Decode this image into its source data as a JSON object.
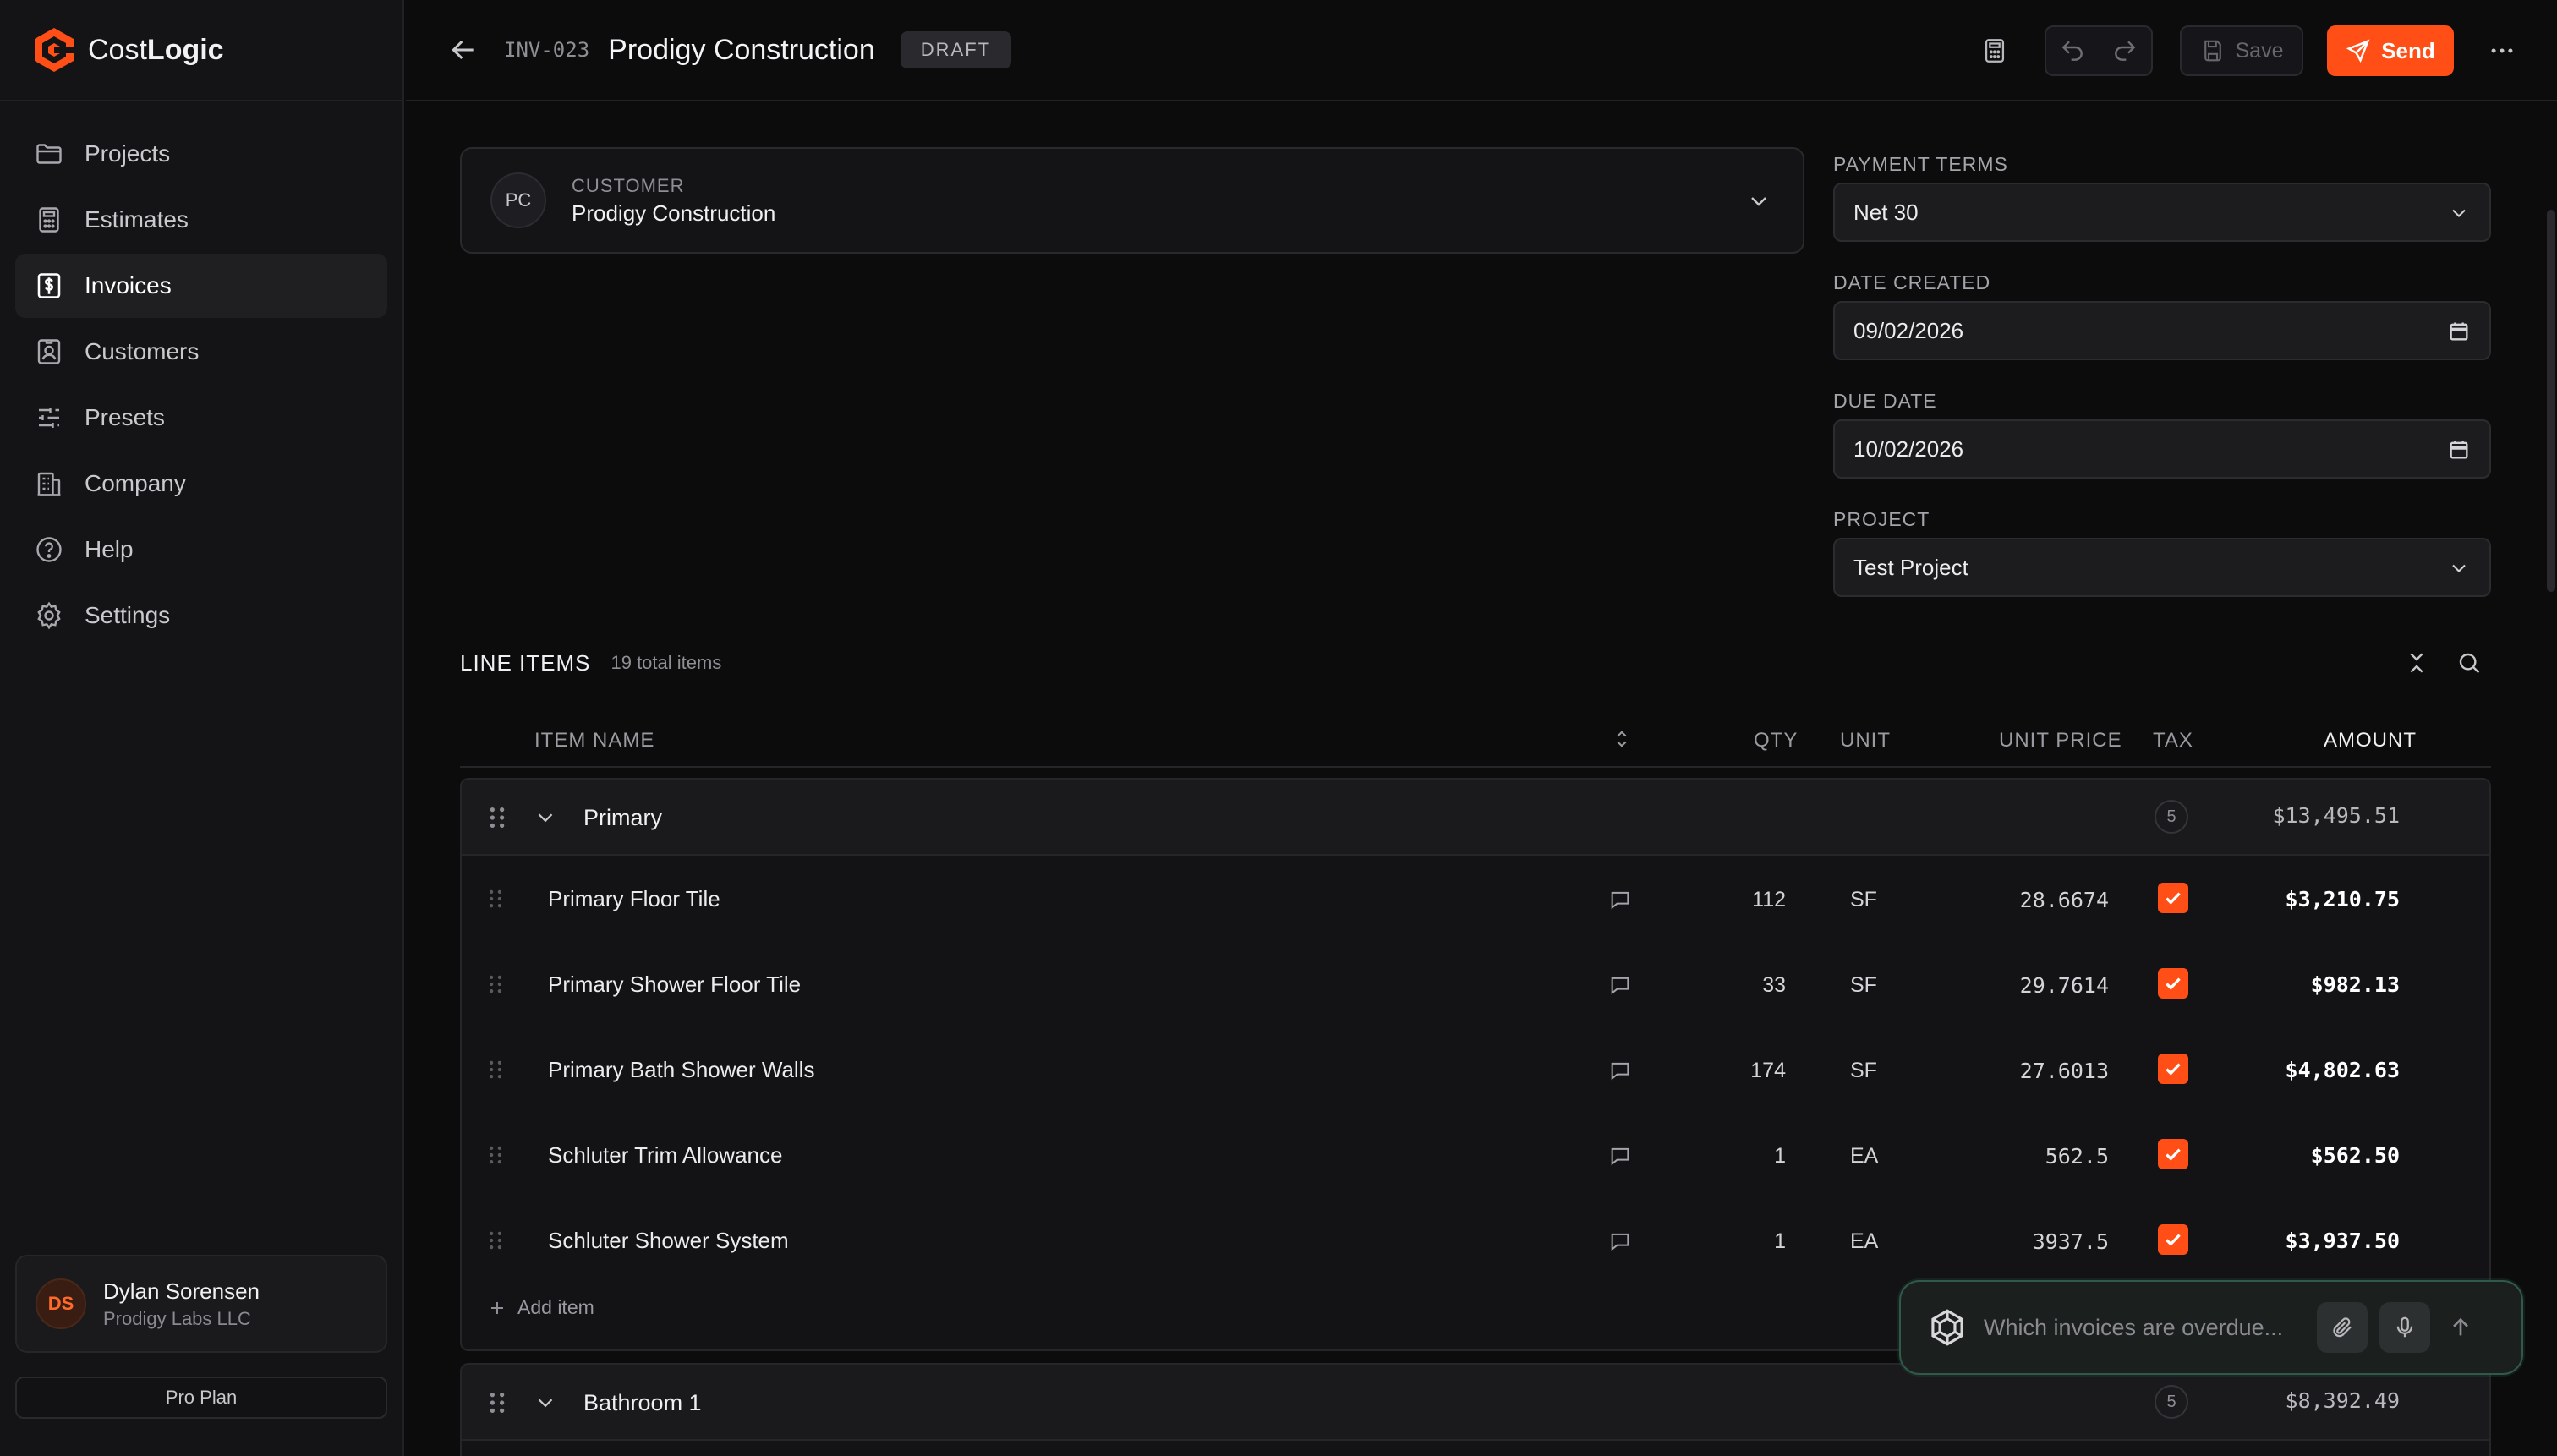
{
  "brand": {
    "name_light": "Cost",
    "name_bold": "Logic",
    "accent": "#ff4f17"
  },
  "sidebar": {
    "items": [
      {
        "label": "Projects",
        "icon": "folder-icon"
      },
      {
        "label": "Estimates",
        "icon": "calculator-icon"
      },
      {
        "label": "Invoices",
        "icon": "invoice-icon",
        "active": true
      },
      {
        "label": "Customers",
        "icon": "contact-card-icon"
      },
      {
        "label": "Presets",
        "icon": "sliders-icon"
      },
      {
        "label": "Company",
        "icon": "building-icon"
      },
      {
        "label": "Help",
        "icon": "help-circle-icon"
      },
      {
        "label": "Settings",
        "icon": "gear-icon"
      }
    ],
    "user": {
      "initials": "DS",
      "name": "Dylan Sorensen",
      "org": "Prodigy Labs LLC"
    },
    "plan": "Pro Plan"
  },
  "header": {
    "invoice_id": "INV-023",
    "title": "Prodigy Construction",
    "status": "DRAFT",
    "save_label": "Save",
    "send_label": "Send"
  },
  "customer": {
    "initials": "PC",
    "label": "CUSTOMER",
    "name": "Prodigy Construction"
  },
  "form": {
    "payment_terms": {
      "label": "PAYMENT TERMS",
      "value": "Net 30"
    },
    "date_created": {
      "label": "DATE CREATED",
      "value": "09/02/2026"
    },
    "due_date": {
      "label": "DUE DATE",
      "value": "10/02/2026"
    },
    "project": {
      "label": "PROJECT",
      "value": "Test Project"
    }
  },
  "line_items": {
    "title": "LINE ITEMS",
    "count": "19 total items",
    "columns": {
      "item_name": "ITEM NAME",
      "qty": "QTY",
      "unit": "UNIT",
      "unit_price": "UNIT PRICE",
      "tax": "TAX",
      "amount": "AMOUNT"
    },
    "groups": [
      {
        "name": "Primary",
        "count": "5",
        "total": "$13,495.51",
        "rows": [
          {
            "name": "Primary Floor Tile",
            "qty": "112",
            "unit": "SF",
            "price": "28.6674",
            "taxed": true,
            "amount": "$3,210.75"
          },
          {
            "name": "Primary Shower Floor Tile",
            "qty": "33",
            "unit": "SF",
            "price": "29.7614",
            "taxed": true,
            "amount": "$982.13"
          },
          {
            "name": "Primary Bath Shower Walls",
            "qty": "174",
            "unit": "SF",
            "price": "27.6013",
            "taxed": true,
            "amount": "$4,802.63"
          },
          {
            "name": "Schluter Trim Allowance",
            "qty": "1",
            "unit": "EA",
            "price": "562.5",
            "taxed": true,
            "amount": "$562.50"
          },
          {
            "name": "Schluter Shower System",
            "qty": "1",
            "unit": "EA",
            "price": "3937.5",
            "taxed": true,
            "amount": "$3,937.50"
          }
        ],
        "add_label": "Add item"
      },
      {
        "name": "Bathroom 1",
        "count": "5",
        "total": "$8,392.49"
      }
    ]
  },
  "chat": {
    "placeholder": "Which invoices are overdue..."
  }
}
